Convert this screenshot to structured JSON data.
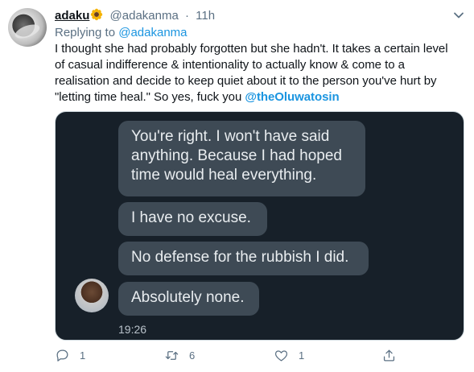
{
  "tweet": {
    "author_name": "adaku",
    "author_handle": "@adakanma",
    "separator": "·",
    "time": "11h",
    "replying_prefix": "Replying to",
    "replying_to": "@adakanma",
    "text_before_mention": "I thought she had probably forgotten but she hadn't. It takes a certain level of casual indifference & intentionality to actually know & come to a realisation and decide to keep quiet about it to the person you've hurt by \"letting time heal.\" So yes, fuck you ",
    "mention": "@theOluwatosin"
  },
  "chat": {
    "messages": [
      "You're right. I won't have said anything. Because I had hoped time would heal everything.",
      "I have no excuse.",
      "No defense for the rubbish I did.",
      "Absolutely none."
    ],
    "timestamp": "19:26"
  },
  "actions": {
    "reply_count": "1",
    "retweet_count": "6",
    "like_count": "1"
  },
  "colors": {
    "link": "#1b95e0",
    "secondary_text": "#5b7083",
    "bubble": "#3e4a55",
    "chat_background": "#172029"
  },
  "icons": [
    "sunflower-emoji",
    "chevron-down-icon",
    "reply-icon",
    "retweet-icon",
    "like-icon",
    "share-icon"
  ]
}
